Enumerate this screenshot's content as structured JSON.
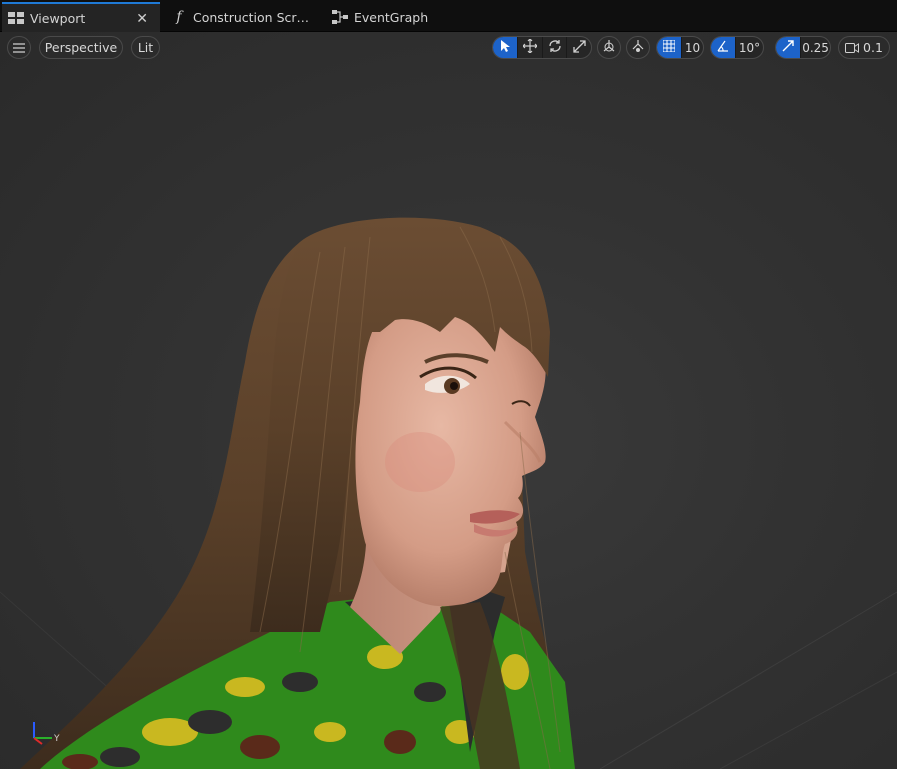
{
  "tabs": [
    {
      "label": "Viewport",
      "icon": "viewport-layout-icon",
      "active": true
    },
    {
      "label": "Construction Scr…",
      "icon": "function-icon",
      "active": false
    },
    {
      "label": "EventGraph",
      "icon": "graph-nodes-icon",
      "active": false
    }
  ],
  "toolbar": {
    "menu_icon": "hamburger-icon",
    "view_mode": "Perspective",
    "lighting_mode": "Lit",
    "transform_tools": [
      "select-icon",
      "move-icon",
      "rotate-icon",
      "scale-icon"
    ],
    "grid_snap_value": "10",
    "rotation_snap_value": "10°",
    "scale_snap_value": "0.25",
    "camera_speed_value": "0.1"
  },
  "axis_gizmo": {
    "y_label": "Y"
  },
  "colors": {
    "accent": "#1d63c9",
    "tab_accent": "#1f7ad6",
    "background": "#333333",
    "hair": "#5a4029",
    "skin": "#d9a48e",
    "shirt_green": "#2f8a1c",
    "shirt_yellow": "#c9b820"
  }
}
